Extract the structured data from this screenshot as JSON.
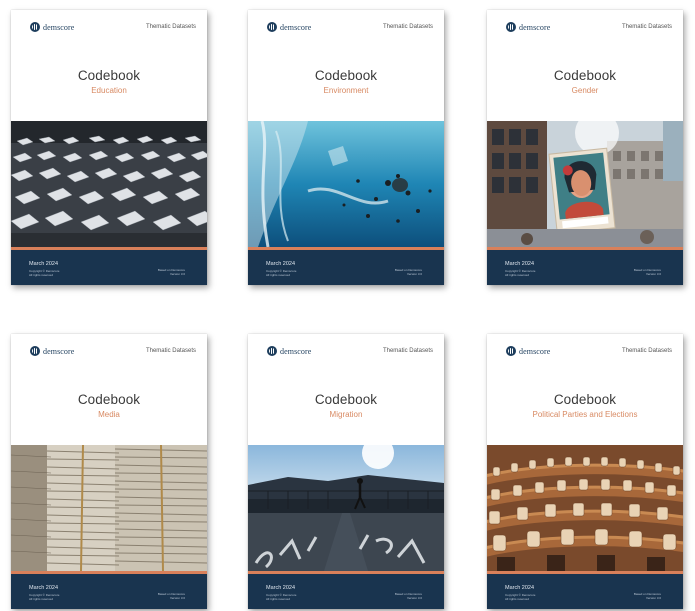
{
  "brand": {
    "logo_text": "demscore",
    "series_label": "Thematic Datasets"
  },
  "common": {
    "title": "Codebook",
    "date": "March 2024",
    "copyright": "Copyright © Demscore",
    "rights": "All rights reserved",
    "based_on": "Based on Demscore",
    "version": "Version 3.0"
  },
  "covers": [
    {
      "topic": "Education",
      "photo": "graduation-caps-icon"
    },
    {
      "topic": "Environment",
      "photo": "underwater-plastic-icon"
    },
    {
      "topic": "Gender",
      "photo": "city-protest-poster-icon"
    },
    {
      "topic": "Media",
      "photo": "newspaper-stacks-icon"
    },
    {
      "topic": "Migration",
      "photo": "bridge-silhouette-icon"
    },
    {
      "topic": "Political Parties and Elections",
      "photo": "parliament-chamber-icon"
    }
  ],
  "colors": {
    "accent": "#d9805a",
    "navy": "#19344f",
    "logo": "#1d3d5c"
  }
}
